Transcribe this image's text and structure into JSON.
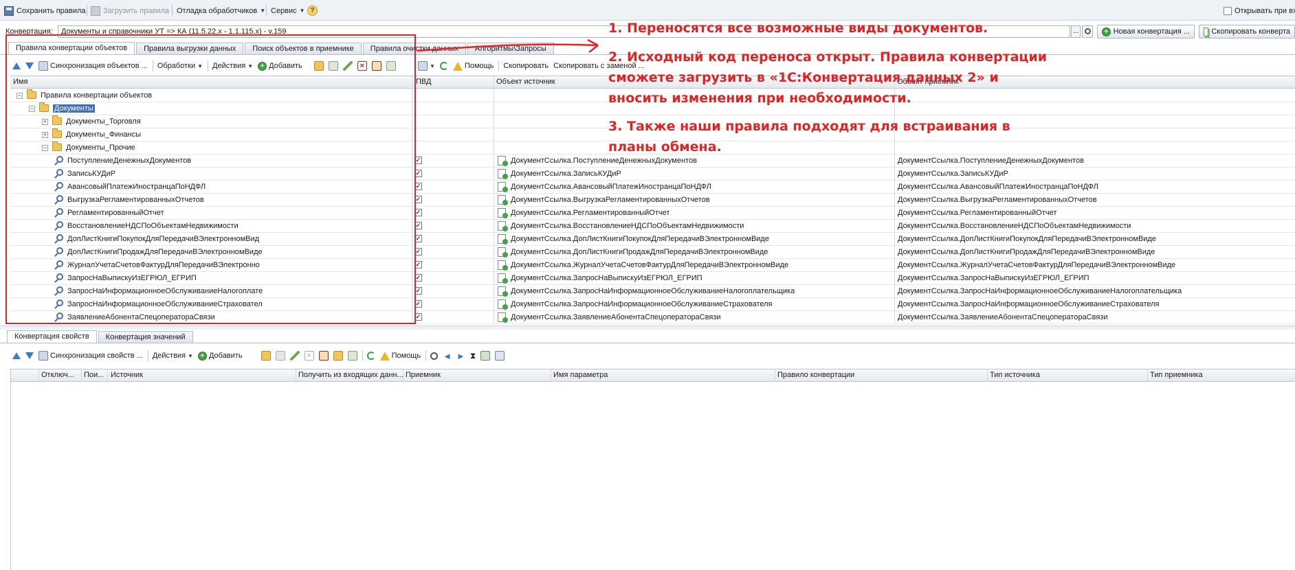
{
  "topbar": {
    "save_rules": "Сохранить правила",
    "load_rules": "Загрузить правила",
    "debug_handlers": "Отладка обработчиков",
    "service": "Сервис",
    "open_in_new_window": "Открывать при вх"
  },
  "conversion": {
    "label": "Конвертация:",
    "value": "Документы и справочники УТ => КА (11.5.22.x - 1.1.115.x) - v.159",
    "new_button": "Новая конвертация ...",
    "copy_button": "Скопировать конверта"
  },
  "top_tabs": [
    "Правила конвертации объектов",
    "Правила выгрузки данных",
    "Поиск объектов в приемнике",
    "Правила очистки данных",
    "Алгоритмы\\Запросы"
  ],
  "top_toolbar": {
    "sync": "Синхронизация объектов ...",
    "handlers": "Обработки",
    "actions": "Действия",
    "add": "Добавить",
    "help": "Помощь",
    "copy": "Скопировать",
    "copy_with_replace": "Скопировать с заменой ..."
  },
  "top_columns": {
    "name": "Имя",
    "pvd": "ПВД",
    "source": "Объект источник",
    "target": "Объект приемник"
  },
  "tree": {
    "root": "Правила конвертации объектов",
    "documents": "Документы",
    "trade": "Документы_Торговля",
    "finance": "Документы_Финансы",
    "other": "Документы_Прочие"
  },
  "rules": [
    {
      "name": "ПоступлениеДенежныхДокументов",
      "source": "ДокументСсылка.ПоступлениеДенежныхДокументов",
      "target": "ДокументСсылка.ПоступлениеДенежныхДокументов"
    },
    {
      "name": "ЗаписьКУДиР",
      "source": "ДокументСсылка.ЗаписьКУДиР",
      "target": "ДокументСсылка.ЗаписьКУДиР"
    },
    {
      "name": "АвансовыйПлатежИностранцаПоНДФЛ",
      "source": "ДокументСсылка.АвансовыйПлатежИностранцаПоНДФЛ",
      "target": "ДокументСсылка.АвансовыйПлатежИностранцаПоНДФЛ"
    },
    {
      "name": "ВыгрузкаРегламентированныхОтчетов",
      "source": "ДокументСсылка.ВыгрузкаРегламентированныхОтчетов",
      "target": "ДокументСсылка.ВыгрузкаРегламентированныхОтчетов"
    },
    {
      "name": "РегламентированныйОтчет",
      "source": "ДокументСсылка.РегламентированныйОтчет",
      "target": "ДокументСсылка.РегламентированныйОтчет"
    },
    {
      "name": "ВосстановлениеНДСПоОбъектамНедвижимости",
      "source": "ДокументСсылка.ВосстановлениеНДСПоОбъектамНедвижимости",
      "target": "ДокументСсылка.ВосстановлениеНДСПоОбъектамНедвижимости"
    },
    {
      "name": "ДопЛистКнигиПокупокДляПередачиВЭлектронномВид",
      "source": "ДокументСсылка.ДопЛистКнигиПокупокДляПередачиВЭлектронномВиде",
      "target": "ДокументСсылка.ДопЛистКнигиПокупокДляПередачиВЭлектронномВиде"
    },
    {
      "name": "ДопЛистКнигиПродажДляПередачиВЭлектронномВиде",
      "source": "ДокументСсылка.ДопЛистКнигиПродажДляПередачиВЭлектронномВиде",
      "target": "ДокументСсылка.ДопЛистКнигиПродажДляПередачиВЭлектронномВиде"
    },
    {
      "name": "ЖурналУчетаСчетовФактурДляПередачиВЭлектронно",
      "source": "ДокументСсылка.ЖурналУчетаСчетовФактурДляПередачиВЭлектронномВиде",
      "target": "ДокументСсылка.ЖурналУчетаСчетовФактурДляПередачиВЭлектронномВиде"
    },
    {
      "name": "ЗапросНаВыпискуИзЕГРЮЛ_ЕГРИП",
      "source": "ДокументСсылка.ЗапросНаВыпискуИзЕГРЮЛ_ЕГРИП",
      "target": "ДокументСсылка.ЗапросНаВыпискуИзЕГРЮЛ_ЕГРИП"
    },
    {
      "name": "ЗапросНаИнформационноеОбслуживаниеНалогоплате",
      "source": "ДокументСсылка.ЗапросНаИнформационноеОбслуживаниеНалогоплательщика",
      "target": "ДокументСсылка.ЗапросНаИнформационноеОбслуживаниеНалогоплательщика"
    },
    {
      "name": "ЗапросНаИнформационноеОбслуживаниеСтраховател",
      "source": "ДокументСсылка.ЗапросНаИнформационноеОбслуживаниеСтрахователя",
      "target": "ДокументСсылка.ЗапросНаИнформационноеОбслуживаниеСтрахователя"
    },
    {
      "name": "ЗаявлениеАбонентаСпецоператораСвязи",
      "source": "ДокументСсылка.ЗаявлениеАбонентаСпецоператораСвязи",
      "target": "ДокументСсылка.ЗаявлениеАбонентаСпецоператораСвязи"
    }
  ],
  "bottom_tabs": [
    "Конвертация свойств",
    "Конвертация значений"
  ],
  "bottom_toolbar": {
    "sync": "Синхронизация свойств ...",
    "actions": "Действия",
    "add": "Добавить",
    "help": "Помощь"
  },
  "bottom_columns": [
    "Отключ...",
    "Пои...",
    "Источник",
    "Получить из входящих данн...",
    "Приемник",
    "Имя параметра",
    "Правило конвертации",
    "Тип источника",
    "Тип приемника"
  ],
  "annotations": [
    "1. Переносятся все возможные виды документов.",
    "2. Исходный код переноса открыт. Правила конвертации",
    "сможете загрузить в «1С:Конвертация данных 2» и",
    "вносить изменения при необходимости.",
    "3. Также наши правила подходят для встраивания в",
    "планы обмена."
  ],
  "colors": {
    "annotation": "#e02424",
    "selection": "#3f6fb5"
  }
}
